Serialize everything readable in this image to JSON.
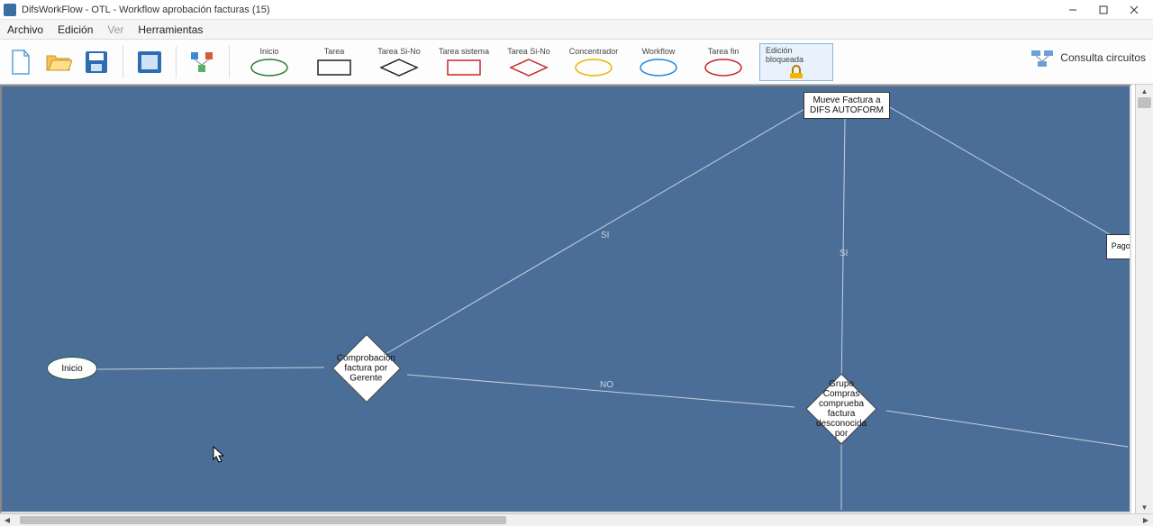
{
  "title": "DifsWorkFlow - OTL - Workflow aprobación facturas (15)",
  "menu": {
    "archivo": "Archivo",
    "edicion": "Edición",
    "ver": "Ver",
    "herramientas": "Herramientas"
  },
  "toolbar": {
    "new": "new-file-icon",
    "open": "open-folder-icon",
    "save": "save-icon",
    "zoom_fit": "fit-icon",
    "layout": "layout-icon",
    "shapes": {
      "inicio": "Inicio",
      "tarea": "Tarea",
      "tarea_sino": "Tarea Si-No",
      "tarea_sistema": "Tarea sistema",
      "tarea_sino2": "Tarea Si-No",
      "concentrador": "Concentrador",
      "workflow": "Workflow",
      "tarea_fin": "Tarea fin"
    },
    "lock": "Edición bloqueada",
    "consulta": "Consulta circuitos"
  },
  "nodes": {
    "inicio": "Inicio",
    "comprobacion": "Comprobación factura por Gerente",
    "mueve": "Mueve Factura a DIFS AUTOFORM",
    "grupo": "Grupo Compras comprueba factura desconocida por",
    "pago": "Pago mover"
  },
  "edge_labels": {
    "si1": "SI",
    "si2": "SI",
    "no": "NO"
  }
}
